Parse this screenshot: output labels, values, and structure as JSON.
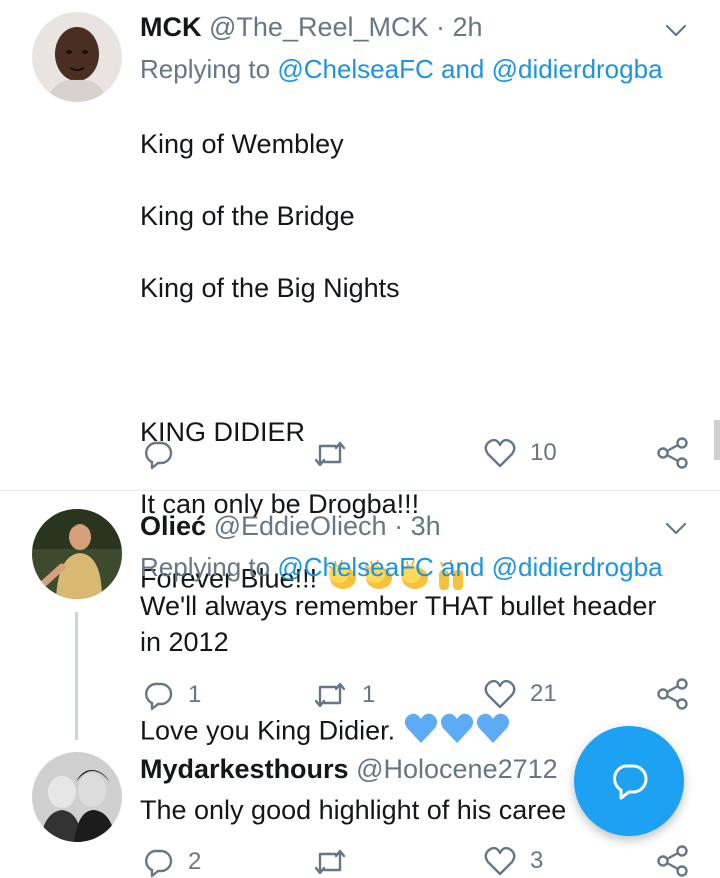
{
  "tweets": [
    {
      "name": "MCK",
      "handle": "@The_Reel_MCK",
      "time": "· 2h",
      "replying_prefix": "Replying to",
      "replying_targets": "@ChelseaFC and @didierdrogba",
      "lines": [
        "King of Wembley",
        "King of the Bridge",
        "King of the Big Nights",
        "",
        "KING DIDIER",
        "It can only be Drogba!!!"
      ],
      "line_forever": "Forever Blue!!!",
      "line_love": "Love you King Didier.",
      "replies": "",
      "retweets": "",
      "likes": "10"
    },
    {
      "name": "Olieć",
      "handle": "@EddieOliech",
      "time": "· 3h",
      "replying_prefix": "Replying to",
      "replying_targets": "@ChelseaFC and @didierdrogba",
      "text": "We'll always remember THAT bullet header\nin 2012",
      "replies": "1",
      "retweets": "1",
      "likes": "21"
    },
    {
      "name": "Mydarkesthours",
      "handle": "@Holocene2712",
      "text": "The only good highlight of his caree",
      "replies": "2",
      "retweets": "",
      "likes": "3"
    }
  ],
  "icons": {
    "reply": "reply-icon",
    "retweet": "retweet-icon",
    "like": "heart-icon",
    "share": "share-icon",
    "more": "chevron-down-icon",
    "compose": "compose-reply-icon"
  },
  "colors": {
    "accent": "#1da1f2",
    "mention": "#1b95e0",
    "secondary_text": "#657786",
    "heart_emoji": "#5daaf5"
  }
}
